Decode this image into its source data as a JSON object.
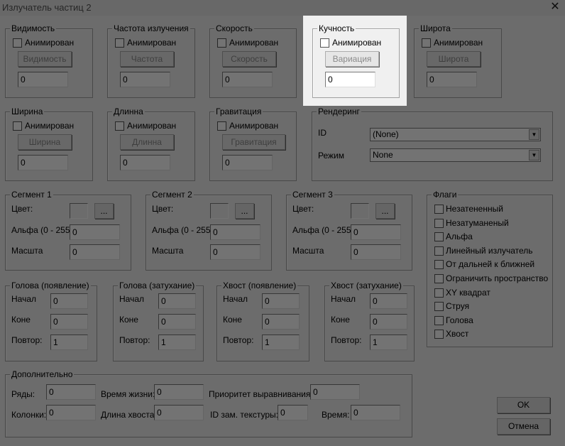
{
  "window": {
    "title": "Излучатель частиц 2"
  },
  "param_groups": [
    {
      "title": "Видимость",
      "checkbox": "Анимирован",
      "button": "Видимость",
      "value": "0"
    },
    {
      "title": "Частота излучения",
      "checkbox": "Анимирован",
      "button": "Частота",
      "value": "0"
    },
    {
      "title": "Скорость",
      "checkbox": "Анимирован",
      "button": "Скорость",
      "value": "0"
    },
    {
      "title": "Кучность",
      "checkbox": "Анимирован",
      "button": "Вариация",
      "value": "0"
    },
    {
      "title": "Широта",
      "checkbox": "Анимирован",
      "button": "Широта",
      "value": "0"
    },
    {
      "title": "Ширина",
      "checkbox": "Анимирован",
      "button": "Ширина",
      "value": "0"
    },
    {
      "title": "Длинна",
      "checkbox": "Анимирован",
      "button": "Длинна",
      "value": "0"
    },
    {
      "title": "Гравитация",
      "checkbox": "Анимирован",
      "button": "Гравитация",
      "value": "0"
    }
  ],
  "rendering": {
    "title": "Рендеринг",
    "id_label": "ID",
    "id_value": "(None)",
    "mode_label": "Режим",
    "mode_value": "None"
  },
  "segments": [
    {
      "title": "Сегмент 1",
      "color_label": "Цвет:",
      "more": "...",
      "alpha_label": "Альфа (0 - 255)",
      "alpha": "0",
      "scale_label": "Масшта",
      "scale": "0"
    },
    {
      "title": "Сегмент 2",
      "color_label": "Цвет:",
      "more": "...",
      "alpha_label": "Альфа (0 - 255)",
      "alpha": "0",
      "scale_label": "Масшта",
      "scale": "0"
    },
    {
      "title": "Сегмент 3",
      "color_label": "Цвет:",
      "more": "...",
      "alpha_label": "Альфа (0 - 255)",
      "alpha": "0",
      "scale_label": "Масшта",
      "scale": "0"
    }
  ],
  "flags": {
    "title": "Флаги",
    "items": [
      "Незатененный",
      "Незатуманеный",
      "Альфа",
      "Линейный излучатель",
      "От дальней к ближней",
      "Ограничить пространство",
      "XY квадрат",
      "Струя",
      "Голова",
      "Хвост"
    ]
  },
  "lifecycle": [
    {
      "title": "Голова (появление)",
      "start_label": "Начал",
      "start": "0",
      "end_label": "Коне",
      "end": "0",
      "repeat_label": "Повтор:",
      "repeat": "1"
    },
    {
      "title": "Голова (затухание)",
      "start_label": "Начал",
      "start": "0",
      "end_label": "Коне",
      "end": "0",
      "repeat_label": "Повтор:",
      "repeat": "1"
    },
    {
      "title": "Хвост (появление)",
      "start_label": "Начал",
      "start": "0",
      "end_label": "Коне",
      "end": "0",
      "repeat_label": "Повтор:",
      "repeat": "1"
    },
    {
      "title": "Хвост (затухание)",
      "start_label": "Начал",
      "start": "0",
      "end_label": "Коне",
      "end": "0",
      "repeat_label": "Повтор:",
      "repeat": "1"
    }
  ],
  "additional": {
    "title": "Дополнительно",
    "fields": [
      {
        "label": "Ряды:",
        "value": "0"
      },
      {
        "label": "Время жизни:",
        "value": "0"
      },
      {
        "label": "Приоритет выравнивания:",
        "value": "0"
      },
      {
        "label": "Колонки:",
        "value": "0"
      },
      {
        "label": "Длина хвоста:",
        "value": "0"
      },
      {
        "label": "ID зам. текстуры:",
        "value": "0"
      },
      {
        "label": "Время:",
        "value": "0"
      }
    ]
  },
  "buttons": {
    "ok": "OK",
    "cancel": "Отмена"
  }
}
